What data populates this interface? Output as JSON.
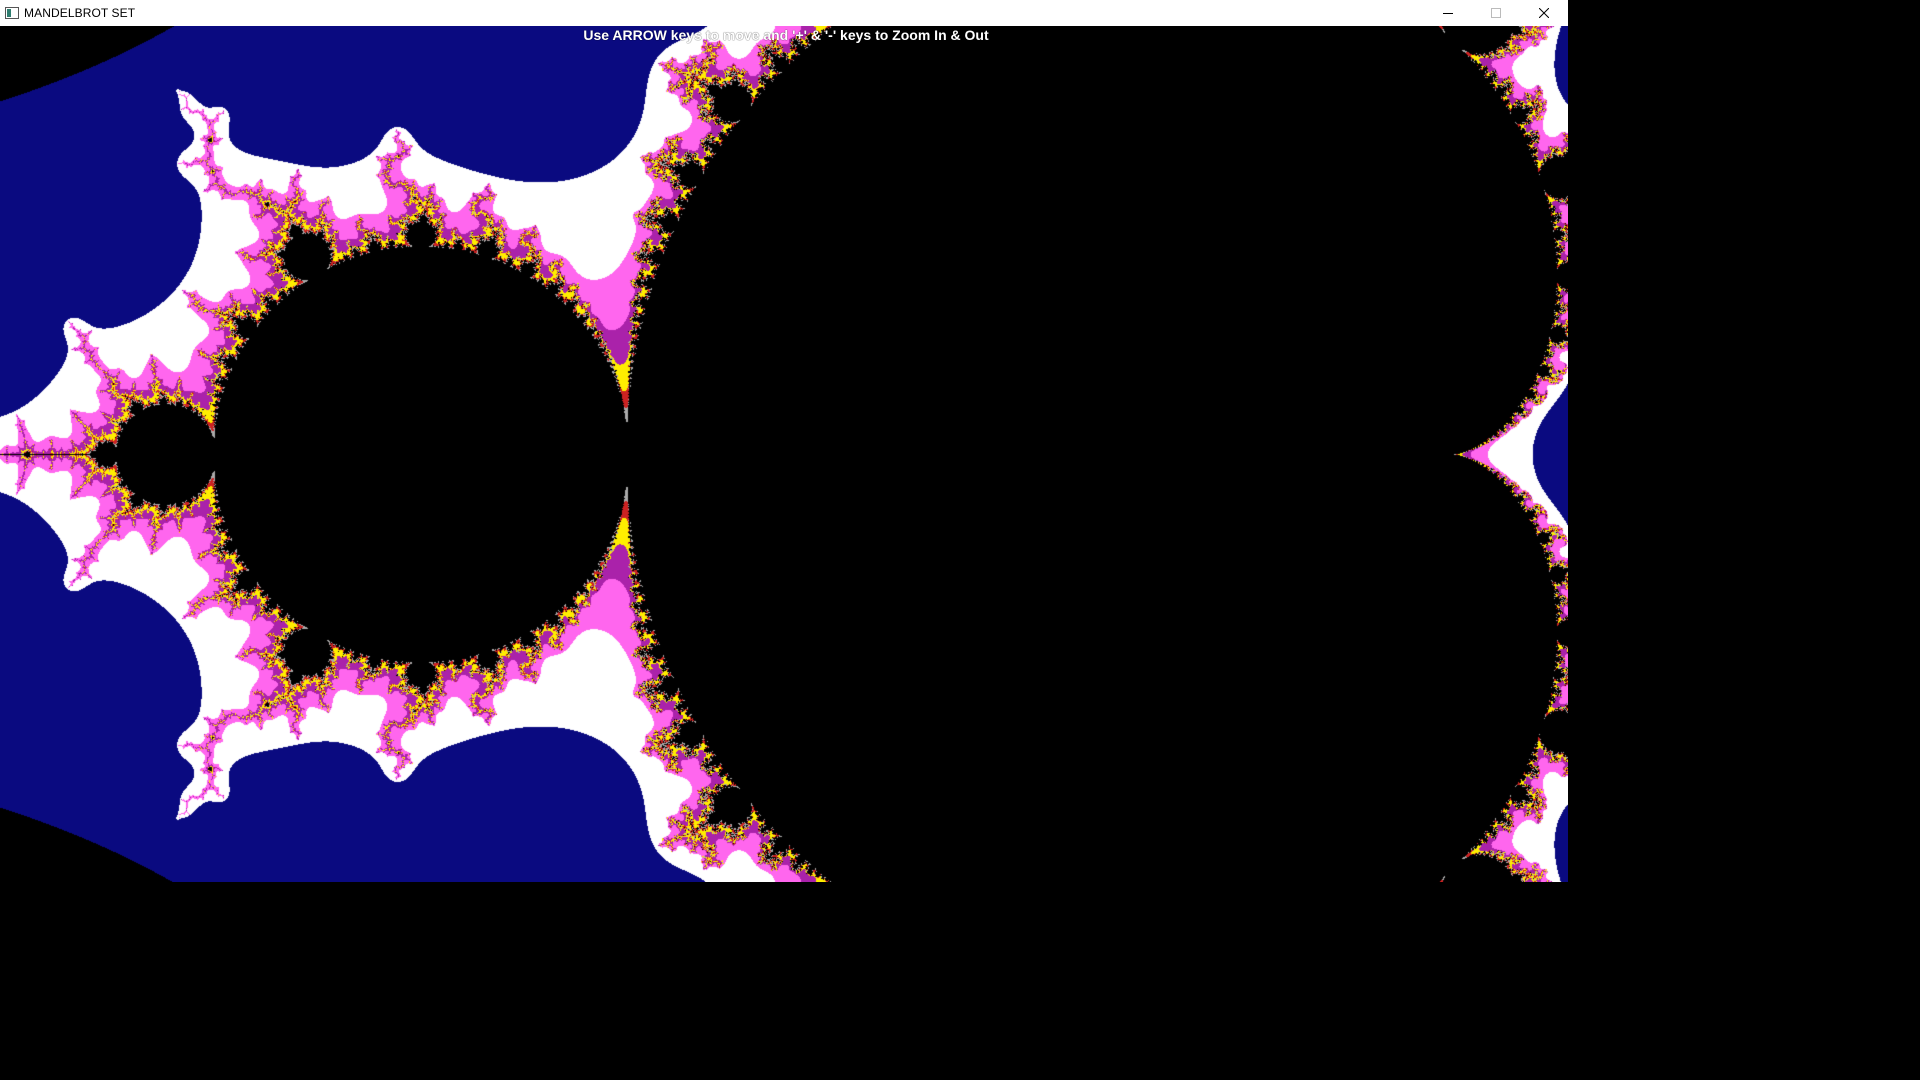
{
  "window": {
    "title": "MANDELBROT SET",
    "icon": "console-window-icon",
    "controls": {
      "minimize": "minimize-icon",
      "maximize": "maximize-icon",
      "close": "close-icon"
    }
  },
  "canvas": {
    "instruction": "Use ARROW keys to move and '+' & '-' keys to Zoom In & Out",
    "colors": {
      "background": "#000000",
      "set": "#000000",
      "outer_band": "#0a0a80",
      "edge_white": "#ffffff",
      "edge_pink": "#ff66ee",
      "edge_magenta": "#aa22aa",
      "edge_yellow": "#ffee00",
      "edge_red": "#cc2222",
      "edge_grey": "#aaaaaa",
      "text": "#ffffff"
    }
  }
}
